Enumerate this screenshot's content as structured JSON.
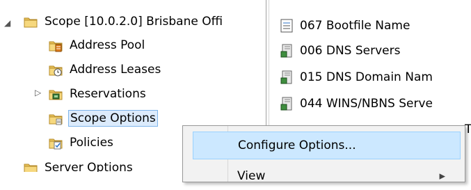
{
  "tree": {
    "scope": {
      "label": "Scope [10.0.2.0] Brisbane Offi",
      "expander": "◢"
    },
    "items": [
      {
        "label": "Address Pool",
        "icon": "address-pool-icon"
      },
      {
        "label": "Address Leases",
        "icon": "address-leases-icon"
      },
      {
        "label": "Reservations",
        "icon": "reservations-icon",
        "expander": "▷"
      },
      {
        "label": "Scope Options",
        "icon": "scope-options-icon",
        "selected": true
      },
      {
        "label": "Policies",
        "icon": "policies-icon"
      }
    ],
    "server_options": {
      "label": "Server Options",
      "icon": "server-options-icon"
    }
  },
  "options_list": [
    {
      "label": "067 Bootfile Name",
      "icon": "option-text-icon"
    },
    {
      "label": "006 DNS Servers",
      "icon": "option-server-icon"
    },
    {
      "label": "015 DNS Domain Nam",
      "icon": "option-server-icon"
    },
    {
      "label": "044 WINS/NBNS Serve",
      "icon": "option-server-icon"
    }
  ],
  "context_menu": {
    "items": [
      {
        "label": "Configure Options...",
        "hover": true
      },
      {
        "label": "View",
        "submenu_arrow": "▸"
      }
    ]
  },
  "overflow_text": "T",
  "colors": {
    "selection_bg": "#dcebfc",
    "menu_hover": "#cce8ff",
    "menu_bg": "#f2f2f2",
    "folder_yellow": "#e8c25a"
  }
}
